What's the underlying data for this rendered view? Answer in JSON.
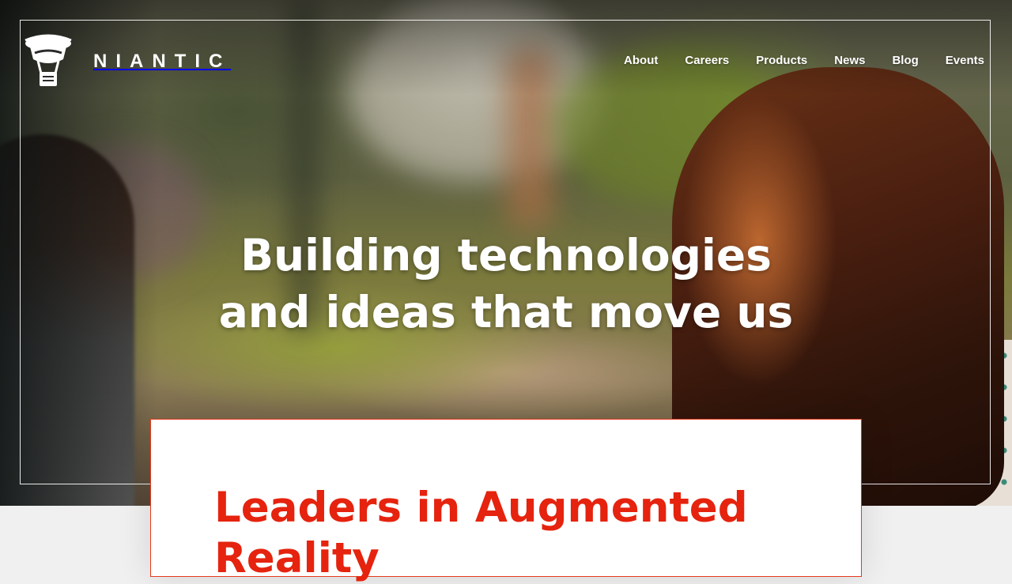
{
  "brand": {
    "wordmark": "NIANTIC",
    "logo_icon": "balloon-logo-icon",
    "text_color": "#ffffff"
  },
  "nav": {
    "items": [
      {
        "label": "About"
      },
      {
        "label": "Careers"
      },
      {
        "label": "Products"
      },
      {
        "label": "News"
      },
      {
        "label": "Blog"
      },
      {
        "label": "Events"
      }
    ]
  },
  "hero": {
    "headline_line1": "Building technologies",
    "headline_line2": "and ideas that move us"
  },
  "intro_card": {
    "title": "Leaders in Augmented Reality",
    "title_color": "#e5230e",
    "border_color": "#e53a1e"
  }
}
